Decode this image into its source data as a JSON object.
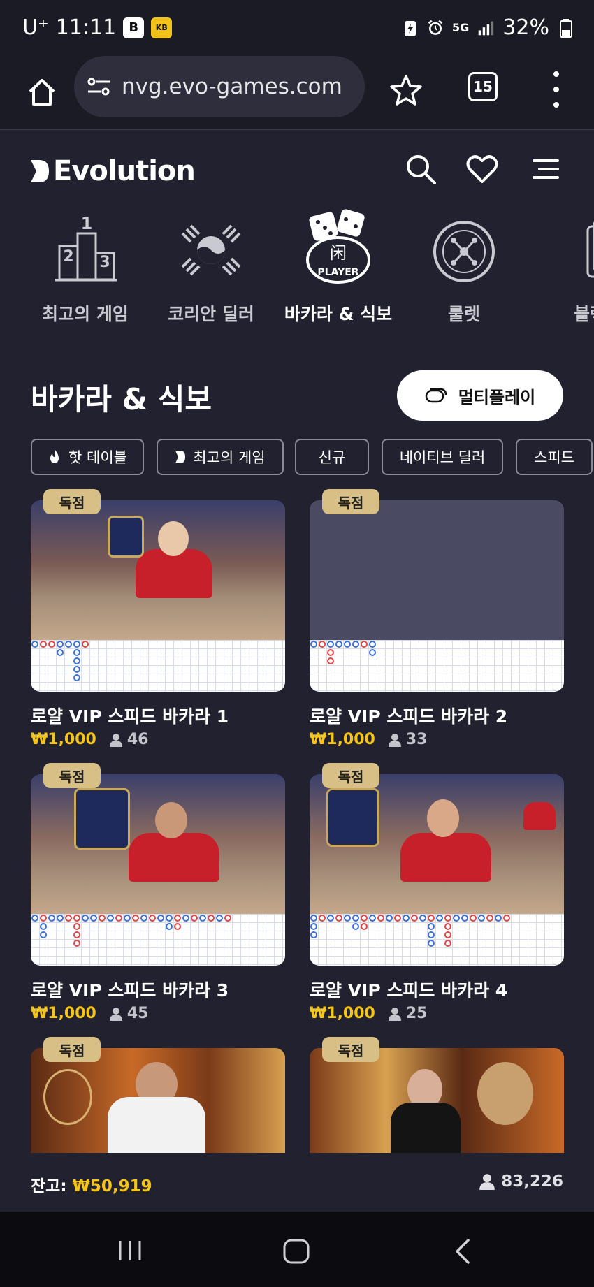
{
  "status_bar": {
    "carrier": "U⁺",
    "time": "11:11",
    "network": "5G",
    "battery": "32%"
  },
  "browser": {
    "url": "nvg.evo-games.com",
    "tab_count": "15"
  },
  "header": {
    "logo_text": "Evolution"
  },
  "categories": [
    {
      "label": "최고의 게임",
      "icon": "podium-icon"
    },
    {
      "label": "코리안 딜러",
      "icon": "taegeuk-icon"
    },
    {
      "label": "바카라 & 식보",
      "icon": "dice-player-icon",
      "active": true
    },
    {
      "label": "룰렛",
      "icon": "roulette-icon"
    },
    {
      "label": "블랙",
      "icon": "playing-card-icon"
    }
  ],
  "section": {
    "title": "바카라 & 식보",
    "multiplay_label": "멀티플레이"
  },
  "filters": [
    {
      "label": "핫 테이블",
      "icon": "flame-icon"
    },
    {
      "label": "최고의 게임",
      "icon": "evolution-mark-icon"
    },
    {
      "label": "신규"
    },
    {
      "label": "네이티브 딜러"
    },
    {
      "label": "스피드"
    }
  ],
  "games": [
    {
      "badge": "독점",
      "title": "로얄 VIP 스피드 바카라 1",
      "price": "₩1,000",
      "players": "46"
    },
    {
      "badge": "독점",
      "title": "로얄 VIP 스피드 바카라 2",
      "price": "₩1,000",
      "players": "33"
    },
    {
      "badge": "독점",
      "title": "로얄 VIP 스피드 바카라 3",
      "price": "₩1,000",
      "players": "45"
    },
    {
      "badge": "독점",
      "title": "로얄 VIP 스피드 바카라 4",
      "price": "₩1,000",
      "players": "25"
    },
    {
      "badge": "독점"
    },
    {
      "badge": "독점"
    }
  ],
  "footer": {
    "balance_label": "잔고:",
    "balance_value": "₩50,919",
    "online_count": "83,226"
  },
  "colors": {
    "background": "#21212f",
    "accent_gold": "#f5c518",
    "badge": "#d8bf86"
  }
}
